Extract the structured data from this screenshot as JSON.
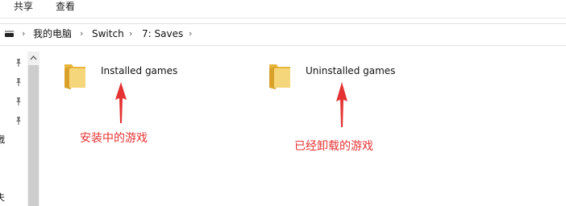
{
  "ribbon": {
    "tabs": [
      "共享",
      "查看"
    ]
  },
  "address_bar": {
    "crumbs": [
      "我的电脑",
      "Switch",
      "7: Saves"
    ],
    "sep": "›"
  },
  "nav_pane": {
    "fragments": [
      "戦",
      "夫"
    ],
    "scroll_up": "⌃"
  },
  "items": [
    {
      "name": "Installed games"
    },
    {
      "name": "Uninstalled games"
    }
  ],
  "annotations": [
    "安装中的游戏",
    "已经卸载的游戏"
  ],
  "colors": {
    "annotation": "#e53333",
    "folder": "#f5d67a",
    "folder_dark": "#e8b53c"
  }
}
